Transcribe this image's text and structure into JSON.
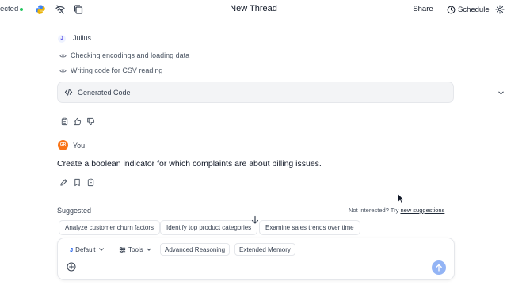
{
  "header": {
    "connection_label": "ected",
    "title": "New Thread",
    "share_label": "Share",
    "schedule_label": "Schedule",
    "status_color": "#22c55e"
  },
  "thread": {
    "assistant_initial": "J",
    "assistant_name": "Julius",
    "steps": [
      "Checking encodings and loading data",
      "Writing code for CSV reading"
    ],
    "code_label": "Generated Code",
    "user_initials": "GR",
    "user_name": "You",
    "user_message": "Create a boolean indicator for which complaints are about billing issues."
  },
  "suggestions": {
    "title": "Suggested",
    "not_interested": "Not interested? Try",
    "new_link": "new suggestions",
    "chips": [
      "Analyze customer churn factors",
      "Identify top product categories",
      "Examine sales trends over time"
    ]
  },
  "composer": {
    "model_icon_letter": "J",
    "model_label": "Default",
    "tools_label": "Tools",
    "reasoning_label": "Advanced Reasoning",
    "memory_label": "Extended Memory",
    "input_value": ""
  },
  "colors": {
    "accent": "#93b4f5",
    "avatar_user": "#f97316",
    "code_bg": "#f3f4f6"
  }
}
